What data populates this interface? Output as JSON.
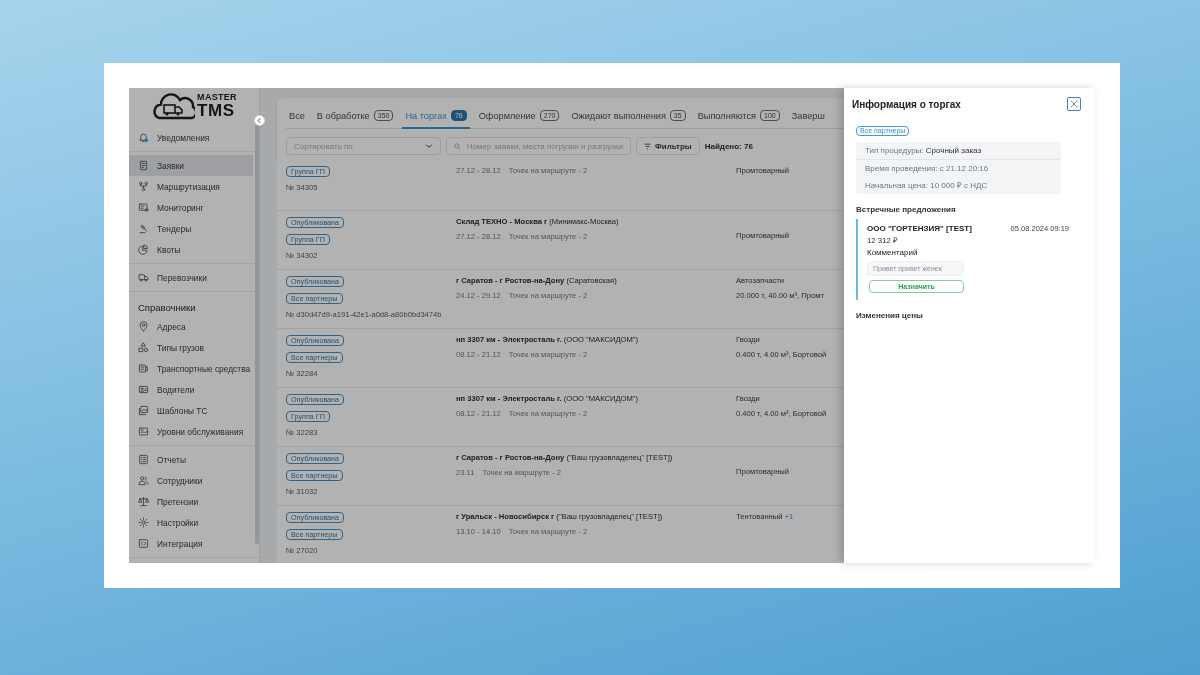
{
  "logo": {
    "line1": "MASTER",
    "line2": "TMS"
  },
  "sidebar": {
    "groups": [
      {
        "items": [
          {
            "label": "Уведомления",
            "selected": false
          }
        ]
      },
      {
        "items": [
          {
            "label": "Заявки",
            "selected": true
          },
          {
            "label": "Маршрутизация",
            "selected": false
          },
          {
            "label": "Мониторинг",
            "selected": false
          },
          {
            "label": "Тендеры",
            "selected": false
          },
          {
            "label": "Квоты",
            "selected": false
          }
        ]
      },
      {
        "items": [
          {
            "label": "Перевозчики",
            "selected": false
          }
        ]
      },
      {
        "title": "Справочники",
        "items": [
          {
            "label": "Адреса",
            "selected": false
          },
          {
            "label": "Типы грузов",
            "selected": false
          },
          {
            "label": "Транспортные средства",
            "selected": false
          },
          {
            "label": "Водители",
            "selected": false
          },
          {
            "label": "Шаблоны ТС",
            "selected": false
          },
          {
            "label": "Уровни обслуживания",
            "selected": false
          }
        ]
      },
      {
        "items": [
          {
            "label": "Отчеты",
            "selected": false
          },
          {
            "label": "Сотрудники",
            "selected": false
          },
          {
            "label": "Претензии",
            "selected": false
          },
          {
            "label": "Настройки",
            "selected": false
          },
          {
            "label": "Интеграция",
            "selected": false
          }
        ]
      }
    ]
  },
  "tabs": [
    {
      "label": "Все",
      "selected": false
    },
    {
      "label": "В обработке",
      "count": "350",
      "selected": false
    },
    {
      "label": "На торгах",
      "count": "76",
      "selected": true
    },
    {
      "label": "Оформление",
      "count": "270",
      "selected": false
    },
    {
      "label": "Ожидают выполнения",
      "count": "35",
      "selected": false
    },
    {
      "label": "Выполняются",
      "count": "100",
      "selected": false
    },
    {
      "label": "Заверш",
      "selected": false
    }
  ],
  "toolbar": {
    "sort": {
      "placeholder": "Сортировать по"
    },
    "search": {
      "placeholder": "Номер заявки, места погрузки и разгрузки"
    },
    "filters": "Фильтры",
    "found": "Найдено: 76"
  },
  "rows": [
    {
      "badges": [
        "Группа ГП"
      ],
      "number": "№ 34305",
      "dates": "27.12 - 28.12",
      "points": "Точек на маршруте - 2",
      "cargo": "Промтоварный"
    },
    {
      "badges": [
        "Опубликована",
        "Группа ГП"
      ],
      "number": "№ 34302",
      "title": "**Склад ТЕХНО - Москва г** (Минимакс-Москва)",
      "dates": "27.12 - 28.12",
      "points": "Точек на маршруте - 2",
      "cargo": "Промтоварный"
    },
    {
      "badges": [
        "Опубликована",
        "Все партнеры"
      ],
      "number": "№ d30d47d9-a191-42e1-a0d8-a80b0bd3474b",
      "title": "**г Саратов - г Ростов-на-Дону** (Саратовская)",
      "dates": "24.12 - 29.12",
      "points": "Точек на маршруте - 2",
      "cargo": "Автозапчасти",
      "details": "20.000 т, 40.00 м³, Промт"
    },
    {
      "badges": [
        "Опубликована",
        "Все партнеры"
      ],
      "number": "№ 32284",
      "title": "**нп 3307 км - Электросталь г.** (ООО \"МАКСИДОМ\")",
      "dates": "08.12 - 21.12",
      "points": "Точек на маршруте - 2",
      "cargo": "Гвозди",
      "details": "0.400 т, 4.00 м³, Бортовой"
    },
    {
      "badges": [
        "Опубликована",
        "Группа ГП"
      ],
      "number": "№ 32283",
      "title": "**нп 3307 км - Электросталь г.** (ООО \"МАКСИДОМ\")",
      "dates": "08.12 - 21.12",
      "points": "Точек на маршруте - 2",
      "cargo": "Гвозди",
      "details": "0.400 т, 4.00 м³, Бортовой"
    },
    {
      "badges": [
        "Опубликована",
        "Все партнеры"
      ],
      "number": "№ 31032",
      "title": "**г Саратов - г Ростов-на-Дону** (\"Ваш грузовладелец\" [TEST])",
      "dates": "23.11",
      "points": "Точек на маршруте - 2",
      "cargo": "Промтоварный"
    },
    {
      "badges": [
        "Опубликована",
        "Все партнеры"
      ],
      "number": "№ 27020",
      "title": "**г Уральск - Новосибирск г** (\"Ваш грузовладелец\" [TEST])",
      "dates": "13.10 - 14.10",
      "points": "Точек на маршруте - 2",
      "cargo": "Тентованный",
      "extra": "+1"
    }
  ],
  "drawer": {
    "title": "Информация о торгах",
    "badge": "Все партнеры",
    "procedure": {
      "label": "Тип процедуры:",
      "value": "Срочный заказ"
    },
    "details": [
      "Время проведения: с 21.12 20:16",
      "Начальная цена: 10 000 ₽ с НДС"
    ],
    "offers_title": "Встречные предложения",
    "offers": [
      {
        "company": "ООО \"ГОРТЕНЗИЯ\" [TEST]",
        "date": "05.08.2024 09:19",
        "price": "12 312 ₽",
        "comment_label": "Комментарий",
        "comment": "Привет привет женек",
        "action": "Назначить"
      }
    ],
    "price_changes_title": "Изменения цены"
  }
}
